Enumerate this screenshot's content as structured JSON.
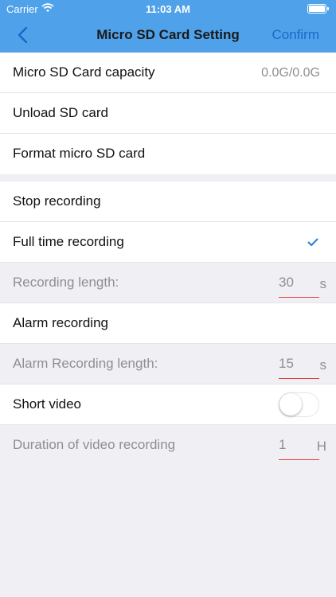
{
  "status_bar": {
    "carrier": "Carrier",
    "time": "11:03 AM"
  },
  "nav": {
    "title": "Micro SD Card Setting",
    "confirm_label": "Confirm",
    "back_icon": "chevron-left-icon"
  },
  "storage": {
    "capacity_label": "Micro SD Card capacity",
    "capacity_value": "0.0G/0.0G",
    "unload_label": "Unload SD card",
    "format_label": "Format micro SD card"
  },
  "recording": {
    "stop_label": "Stop recording",
    "full_time_label": "Full time recording",
    "full_time_selected": true,
    "length_label": "Recording length:",
    "length_value": "30",
    "length_unit": "s",
    "alarm_label": "Alarm recording",
    "alarm_length_label": "Alarm Recording length:",
    "alarm_length_value": "15",
    "alarm_length_unit": "s",
    "short_video_label": "Short video",
    "short_video_on": false,
    "duration_label": "Duration of video recording",
    "duration_value": "1",
    "duration_unit": "H"
  },
  "colors": {
    "header_bg": "#4fa2e9",
    "accent_blue": "#1a67c8",
    "underline_red": "#e04040",
    "check_blue": "#2b7bd6"
  }
}
